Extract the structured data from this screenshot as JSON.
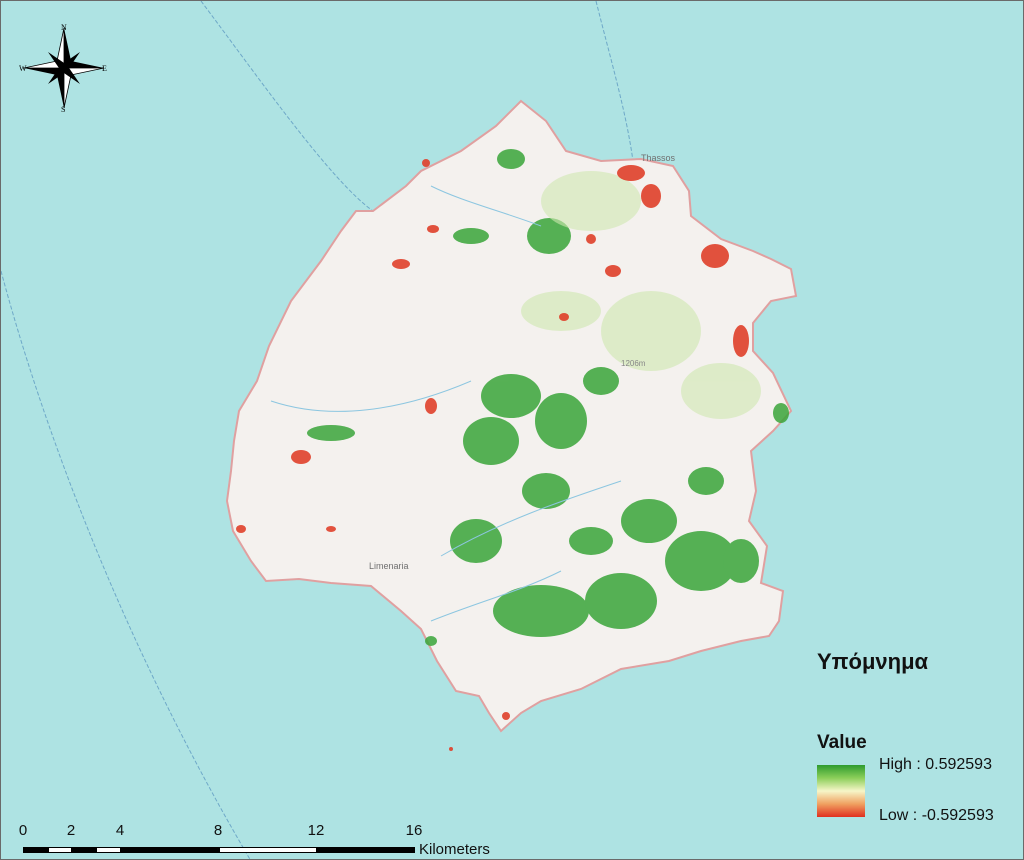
{
  "compass": {
    "north": "N",
    "south": "S",
    "east": "E",
    "west": "W",
    "icon": "compass-rose-icon"
  },
  "labels": {
    "town_north": "Thassos",
    "town_southwest": "Limenaria",
    "peak": "1206m"
  },
  "legend": {
    "title": "Υπόμνημα",
    "field": "Value",
    "high_label": "High : 0.592593",
    "low_label": "Low : -0.592593",
    "high_color": "#2e9b2e",
    "low_color": "#e03020"
  },
  "scalebar": {
    "ticks": [
      "0",
      "2",
      "4",
      "8",
      "12",
      "16"
    ],
    "unit": "Kilometers"
  },
  "colors": {
    "sea": "#aee3e3",
    "land": "#f4f1ee",
    "coast": "#e0a0a0"
  }
}
